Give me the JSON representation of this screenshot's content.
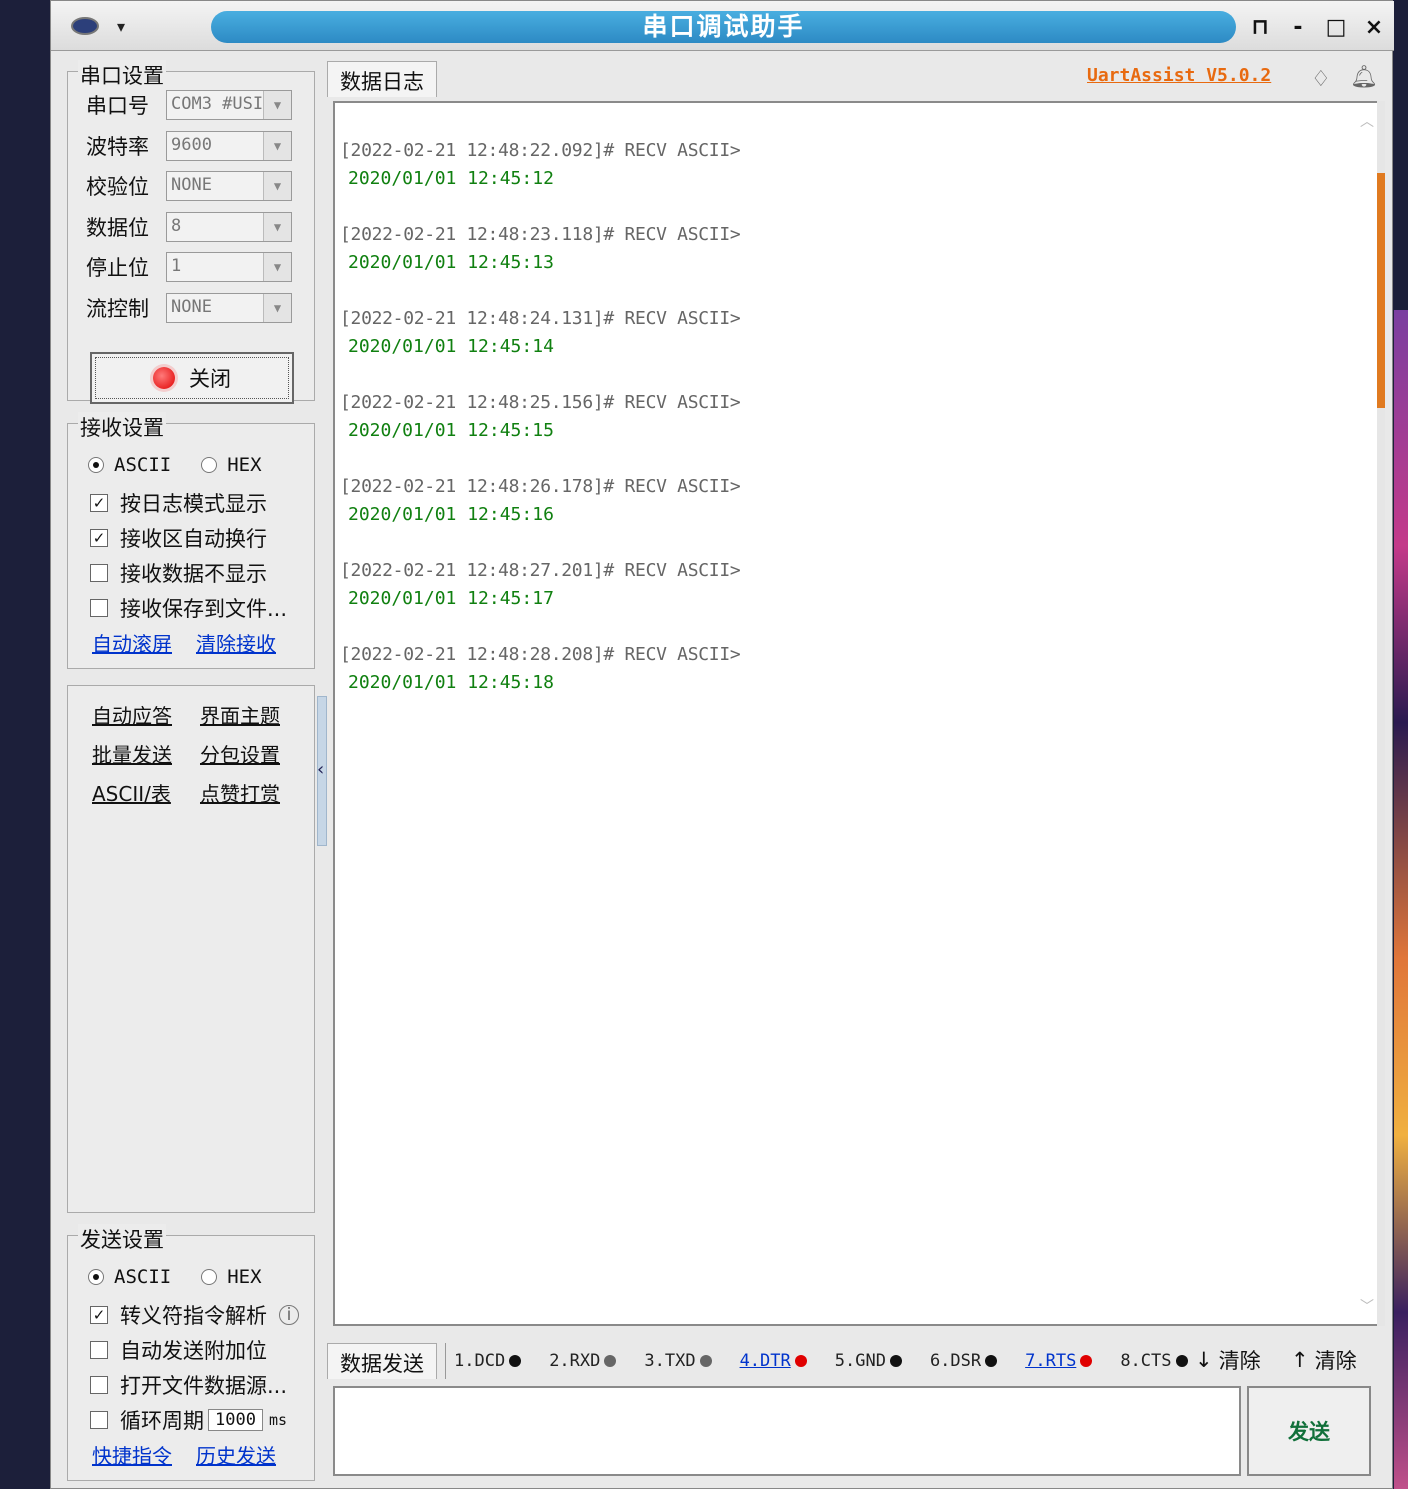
{
  "window": {
    "title": "串口调试助手",
    "buttons": [
      "-",
      "□",
      "×"
    ]
  },
  "port_settings": {
    "title": "串口设置",
    "fields": [
      {
        "label": "串口号",
        "value": "COM3 #USI"
      },
      {
        "label": "波特率",
        "value": "9600"
      },
      {
        "label": "校验位",
        "value": "NONE"
      },
      {
        "label": "数据位",
        "value": "8"
      },
      {
        "label": "停止位",
        "value": "1"
      },
      {
        "label": "流控制",
        "value": "NONE"
      }
    ],
    "close_label": "关闭"
  },
  "receive_settings": {
    "title": "接收设置",
    "mode_ascii": "ASCII",
    "mode_hex": "HEX",
    "options": [
      {
        "label": "按日志模式显示",
        "checked": true
      },
      {
        "label": "接收区自动换行",
        "checked": true
      },
      {
        "label": "接收数据不显示",
        "checked": false
      },
      {
        "label": "接收保存到文件...",
        "checked": false
      }
    ],
    "link_autoscroll": "自动滚屏",
    "link_clear": "清除接收"
  },
  "tools": {
    "items": [
      "自动应答",
      "界面主题",
      "批量发送",
      "分包设置",
      "ASCII/表",
      "点赞打赏"
    ]
  },
  "send_settings": {
    "title": "发送设置",
    "mode_ascii": "ASCII",
    "mode_hex": "HEX",
    "options": [
      {
        "label": "转义符指令解析",
        "checked": true
      },
      {
        "label": "自动发送附加位",
        "checked": false
      },
      {
        "label": "打开文件数据源...",
        "checked": false
      },
      {
        "label": "循环周期",
        "checked": false
      }
    ],
    "period_value": "1000",
    "period_unit": "ms",
    "link_shortcuts": "快捷指令",
    "link_history": "历史发送"
  },
  "log": {
    "tab_label": "数据日志",
    "version": "UartAssist V5.0.2",
    "entries": [
      {
        "header": "[2022-02-21 12:48:22.092]# RECV ASCII>",
        "body": "2020/01/01 12:45:12"
      },
      {
        "header": "[2022-02-21 12:48:23.118]# RECV ASCII>",
        "body": "2020/01/01 12:45:13"
      },
      {
        "header": "[2022-02-21 12:48:24.131]# RECV ASCII>",
        "body": "2020/01/01 12:45:14"
      },
      {
        "header": "[2022-02-21 12:48:25.156]# RECV ASCII>",
        "body": "2020/01/01 12:45:15"
      },
      {
        "header": "[2022-02-21 12:48:26.178]# RECV ASCII>",
        "body": "2020/01/01 12:45:16"
      },
      {
        "header": "[2022-02-21 12:48:27.201]# RECV ASCII>",
        "body": "2020/01/01 12:45:17"
      },
      {
        "header": "[2022-02-21 12:48:28.208]# RECV ASCII>",
        "body": "2020/01/01 12:45:18"
      }
    ]
  },
  "send_area": {
    "tab_label": "数据发送",
    "pins": [
      {
        "label": "1.DCD",
        "color": "#111111",
        "link": false
      },
      {
        "label": "2.RXD",
        "color": "#666666",
        "link": false
      },
      {
        "label": "3.TXD",
        "color": "#666666",
        "link": false
      },
      {
        "label": "4.DTR",
        "color": "#e00000",
        "link": true
      },
      {
        "label": "5.GND",
        "color": "#111111",
        "link": false
      },
      {
        "label": "6.DSR",
        "color": "#111111",
        "link": false
      },
      {
        "label": "7.RTS",
        "color": "#e00000",
        "link": true
      },
      {
        "label": "8.CTS",
        "color": "#111111",
        "link": false
      }
    ],
    "clear_recv_label": "清除",
    "clear_send_label": "清除",
    "send_label": "发送"
  },
  "colors": {
    "accent": "#2d8ac4",
    "link": "#0033cc",
    "version": "#e86a10",
    "recv_text": "#108010"
  }
}
